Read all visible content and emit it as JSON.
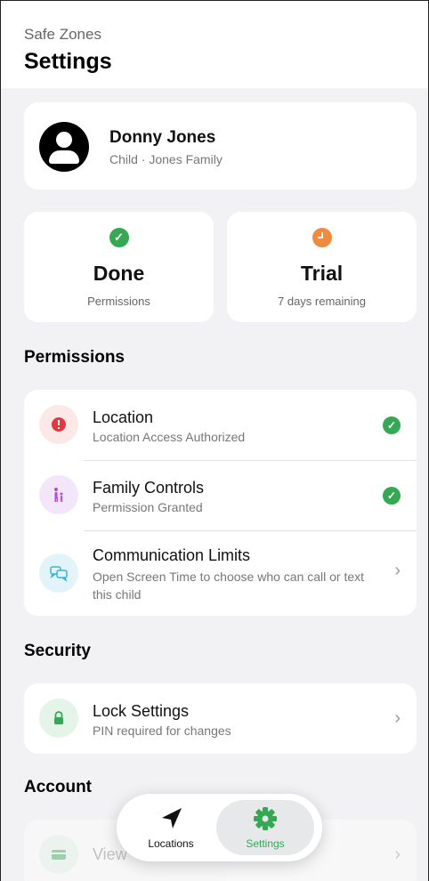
{
  "header": {
    "supertitle": "Safe Zones",
    "title": "Settings"
  },
  "profile": {
    "name": "Donny Jones",
    "subtitle": "Child · Jones Family"
  },
  "stats": [
    {
      "value": "Done",
      "label": "Permissions",
      "icon": "check-circle-icon",
      "color": "#34a853"
    },
    {
      "value": "Trial",
      "label": "7 days remaining",
      "icon": "clock-icon",
      "color": "#f08a3e"
    }
  ],
  "sections": {
    "permissions": "Permissions",
    "security": "Security",
    "account": "Account"
  },
  "permissions": [
    {
      "title": "Location",
      "desc": "Location Access Authorized",
      "icon": "exclamation-icon",
      "status": "check"
    },
    {
      "title": "Family Controls",
      "desc": "Permission Granted",
      "icon": "family-icon",
      "status": "check"
    },
    {
      "title": "Communication Limits",
      "desc": "Open Screen Time to choose who can call or text this child",
      "icon": "chat-bubbles-icon",
      "status": "chevron"
    }
  ],
  "security": {
    "title": "Lock Settings",
    "desc": "PIN required for changes",
    "icon": "lock-icon"
  },
  "account": {
    "title": "View",
    "icon": "card-icon"
  },
  "tabs": [
    {
      "label": "Locations",
      "icon": "location-arrow-icon",
      "selected": false
    },
    {
      "label": "Settings",
      "icon": "gear-icon",
      "selected": true
    }
  ],
  "colors": {
    "green": "#34a853",
    "orange": "#f08a3e",
    "red": "#e0393e",
    "purple": "#b44ad6",
    "teal": "#3bb3d6"
  }
}
